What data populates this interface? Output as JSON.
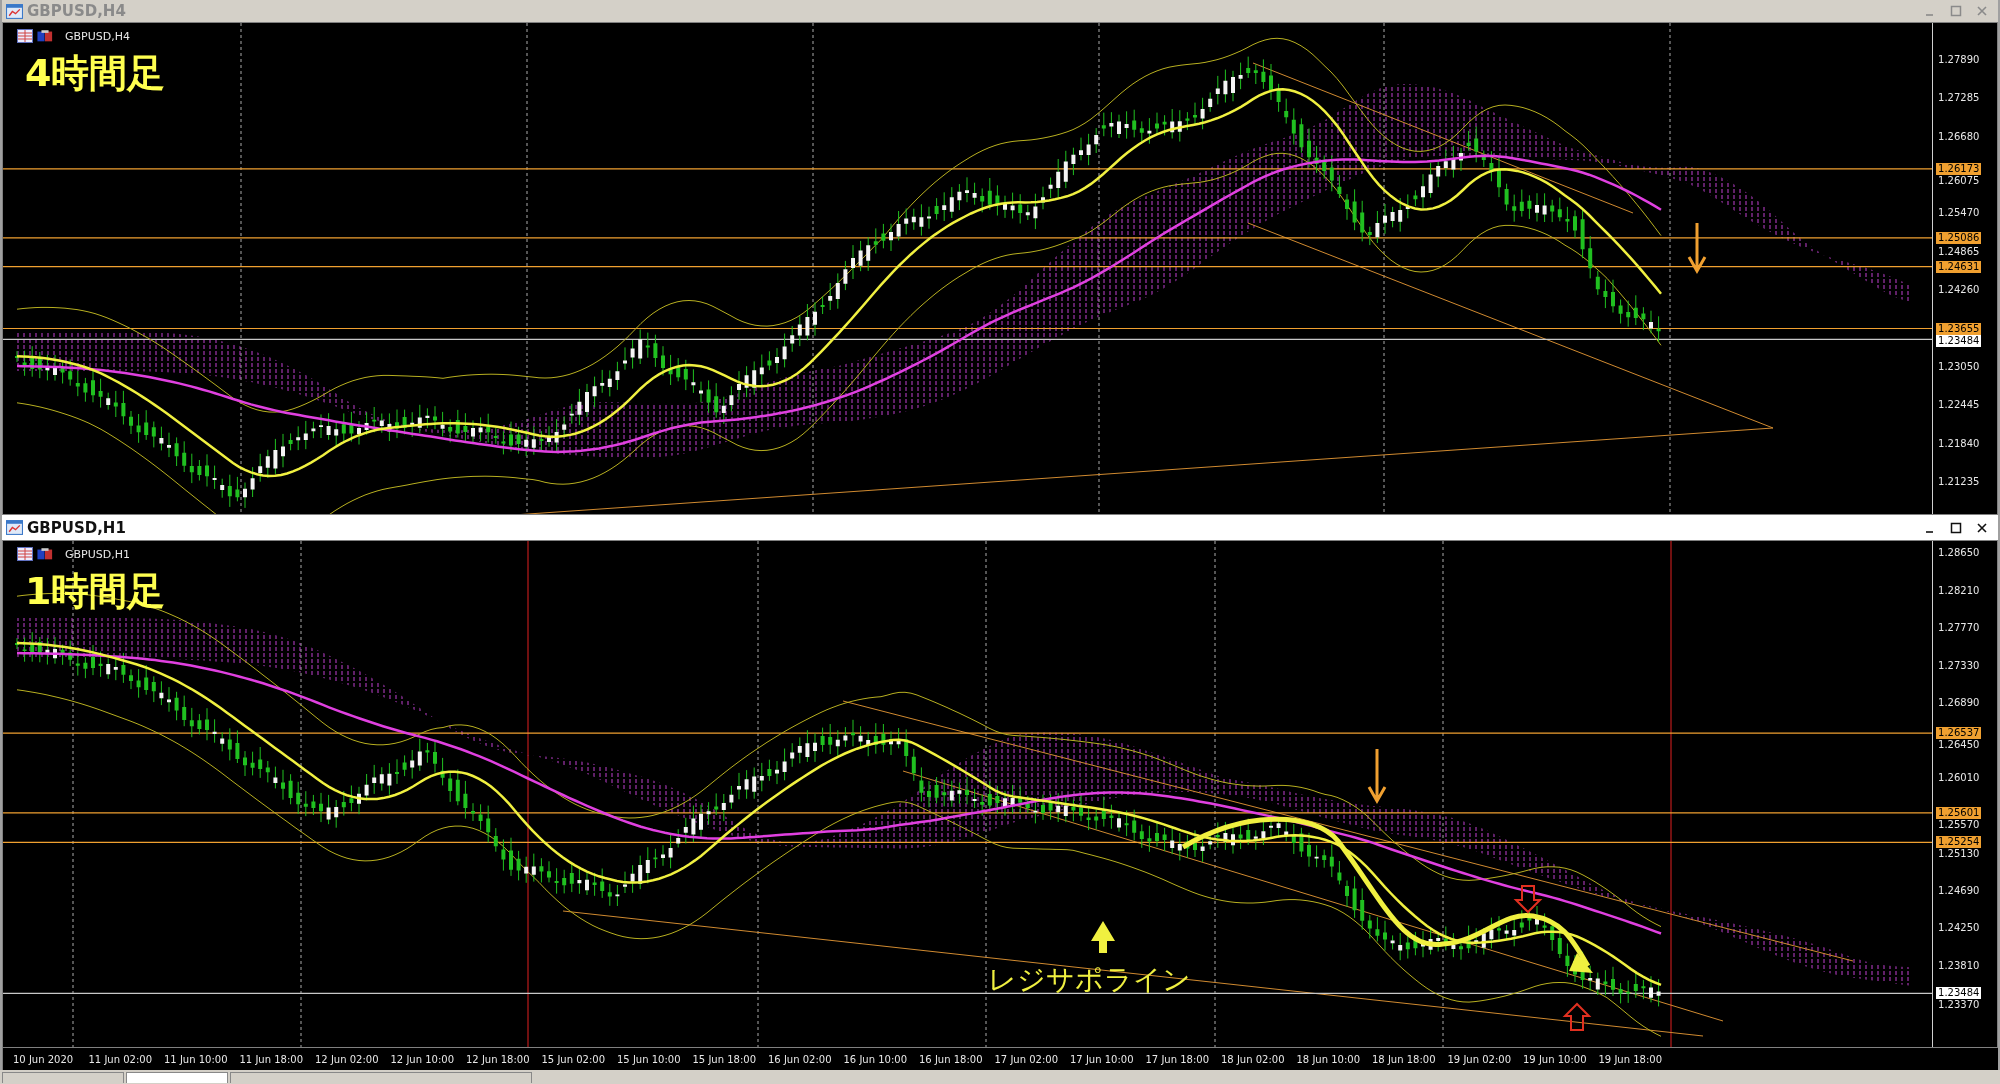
{
  "windows": [
    {
      "title": "GBPUSD,H4",
      "active": false,
      "symbol_label": "GBPUSD,H4",
      "caption": "4時間足",
      "price_ticks": [
        "1.27890",
        "1.27285",
        "1.26680",
        "1.26075",
        "1.25470",
        "1.24865",
        "1.24260",
        "1.23050",
        "1.22445",
        "1.21840",
        "1.21235"
      ],
      "price_lines": [
        {
          "price": "1.26173",
          "kind": "level"
        },
        {
          "price": "1.25086",
          "kind": "level"
        },
        {
          "price": "1.24631",
          "kind": "level"
        },
        {
          "price": "1.23655",
          "kind": "level"
        },
        {
          "price": "1.23484",
          "kind": "bid"
        }
      ]
    },
    {
      "title": "GBPUSD,H1",
      "active": true,
      "symbol_label": "GBPUSD,H1",
      "caption": "1時間足",
      "price_ticks": [
        "1.28650",
        "1.28210",
        "1.27770",
        "1.27330",
        "1.26890",
        "1.26450",
        "1.26010",
        "1.25570",
        "1.25130",
        "1.24690",
        "1.24250",
        "1.23810",
        "1.23370"
      ],
      "price_lines": [
        {
          "price": "1.26537",
          "kind": "level"
        },
        {
          "price": "1.25601",
          "kind": "level"
        },
        {
          "price": "1.25254",
          "kind": "level"
        },
        {
          "price": "1.23484",
          "kind": "bid"
        }
      ],
      "annotation": "レジサポライン",
      "time_axis": [
        "10 Jun 2020",
        "11 Jun 02:00",
        "11 Jun 10:00",
        "11 Jun 18:00",
        "12 Jun 02:00",
        "12 Jun 10:00",
        "12 Jun 18:00",
        "15 Jun 02:00",
        "15 Jun 10:00",
        "15 Jun 18:00",
        "16 Jun 02:00",
        "16 Jun 10:00",
        "16 Jun 18:00",
        "17 Jun 02:00",
        "17 Jun 10:00",
        "17 Jun 18:00",
        "18 Jun 02:00",
        "18 Jun 10:00",
        "18 Jun 18:00",
        "19 Jun 02:00",
        "19 Jun 10:00",
        "19 Jun 18:00"
      ]
    }
  ],
  "tabs": [
    {
      "selected": false
    },
    {
      "selected": true
    },
    {
      "selected": false
    }
  ]
}
